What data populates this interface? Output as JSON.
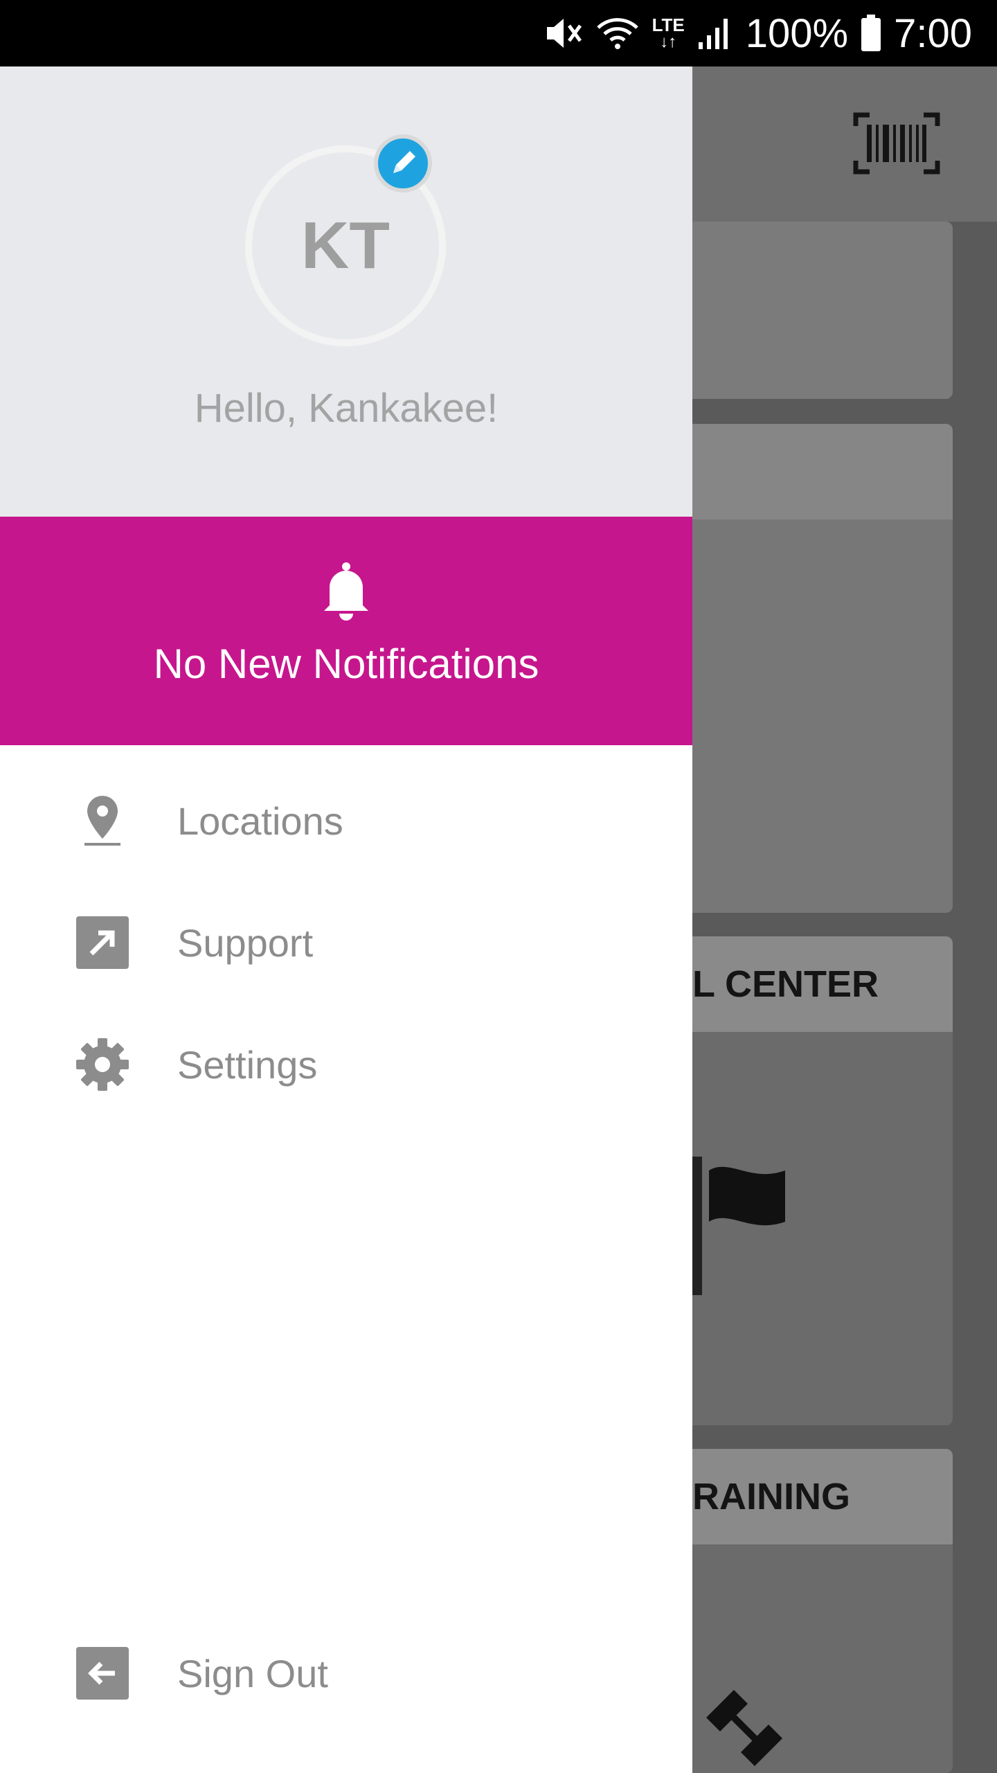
{
  "status_bar": {
    "network": "LTE",
    "battery": "100%",
    "time": "7:00",
    "icons": [
      "mute-icon",
      "wifi-icon",
      "lte-icon",
      "signal-icon",
      "battery-icon"
    ]
  },
  "background_app": {
    "cards": [
      {
        "title": ""
      },
      {
        "title": ""
      },
      {
        "title": "L CENTER"
      },
      {
        "title": "RAINING"
      }
    ]
  },
  "drawer": {
    "profile": {
      "initials": "KT",
      "greeting": "Hello, Kankakee!"
    },
    "notifications": {
      "label": "No New Notifications"
    },
    "menu": [
      {
        "label": "Locations",
        "icon": "location-pin-icon"
      },
      {
        "label": "Support",
        "icon": "external-link-icon"
      },
      {
        "label": "Settings",
        "icon": "gear-icon"
      }
    ],
    "sign_out": {
      "label": "Sign Out",
      "icon": "sign-out-icon"
    }
  },
  "colors": {
    "notification_bar": "#c6168d",
    "edit_badge": "#1fa3e0",
    "profile_bg": "#e8e9ec",
    "menu_text": "#8c8c8c"
  }
}
